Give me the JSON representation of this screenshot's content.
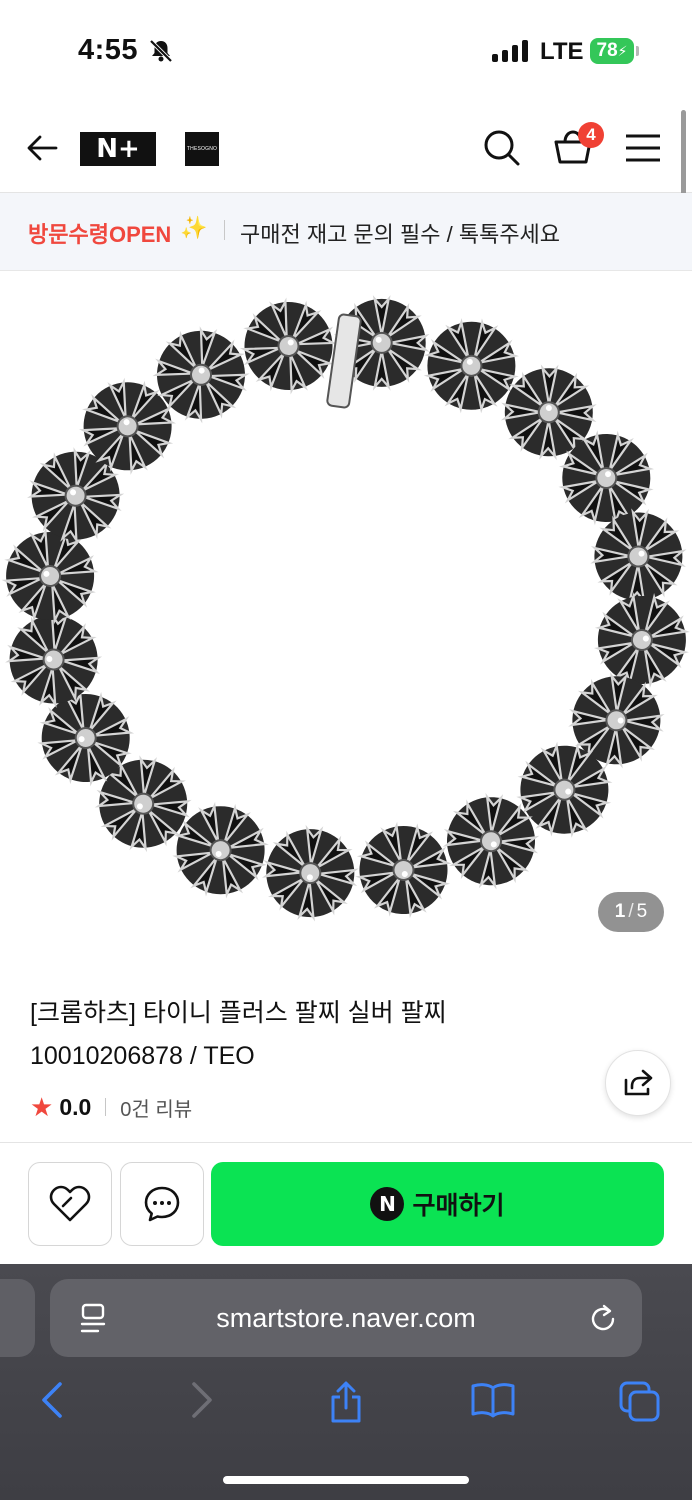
{
  "status": {
    "time": "4:55",
    "network": "LTE",
    "battery": "78"
  },
  "header": {
    "brand_badge": "N+",
    "store_logo_text": "THESOGNO",
    "cart_count": "4"
  },
  "notice": {
    "tag": "방문수령OPEN",
    "sparkle": "✨",
    "text": "구매전 재고 문의 필수 / 톡톡주세요"
  },
  "gallery": {
    "current": "1",
    "separator": "/",
    "total": "5"
  },
  "product": {
    "title_line1": "[크롬하츠] 타이니 플러스 팔찌 실버 팔찌",
    "title_line2": "10010206878 / TEO",
    "rating": "0.0",
    "reviews": "0건 리뷰"
  },
  "actions": {
    "buy_label": "구매하기",
    "buy_badge": "N"
  },
  "browser": {
    "url": "smartstore.naver.com"
  },
  "colors": {
    "buy_green": "#0be353",
    "badge_red": "#f04134",
    "notice_red": "#f0483e",
    "ios_blue": "#3d82f6"
  },
  "icons": [
    "bell-off-icon",
    "back-arrow-icon",
    "search-icon",
    "cart-icon",
    "menu-icon",
    "share-icon",
    "heart-link-icon",
    "chat-icon",
    "reader-icon",
    "reload-icon",
    "chevron-left-icon",
    "chevron-right-icon",
    "share-up-icon",
    "book-icon",
    "tabs-icon"
  ]
}
